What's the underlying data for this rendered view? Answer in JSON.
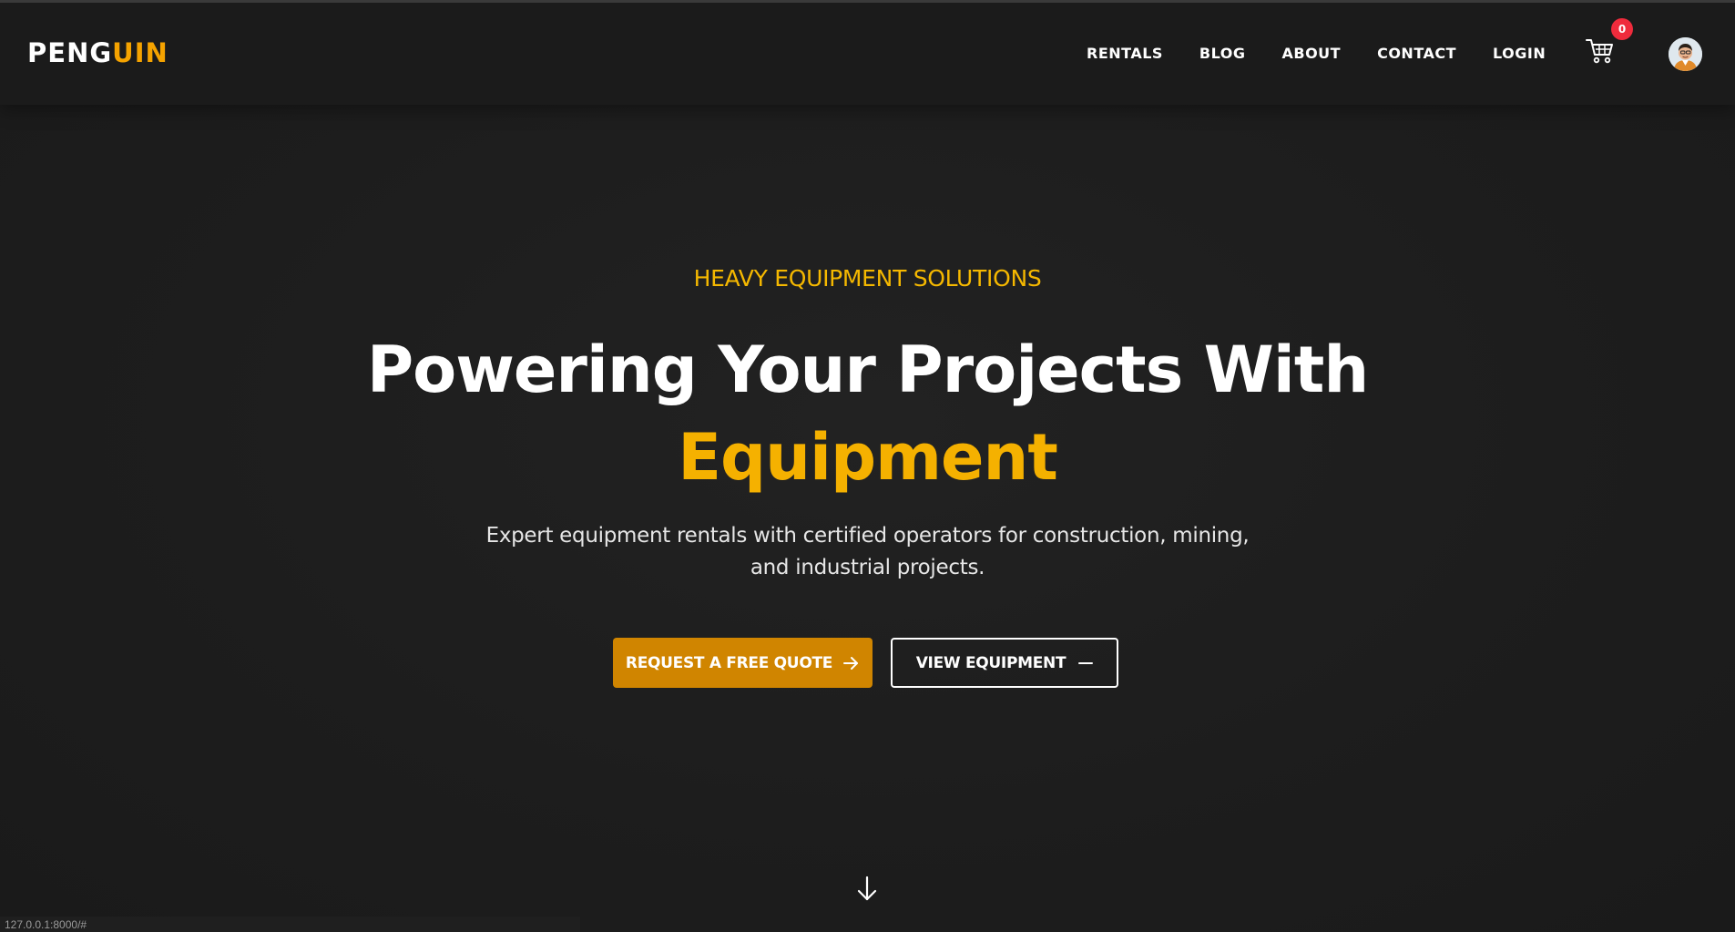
{
  "header": {
    "logo_main": "PENG",
    "logo_accent": "UIN",
    "nav": {
      "rentals": "RENTALS",
      "blog": "BLOG",
      "about": "ABOUT",
      "contact": "CONTACT",
      "login": "LOGIN"
    },
    "cart_icon": "shopping-cart-icon",
    "cart_count": "0",
    "avatar_icon": "user-avatar"
  },
  "hero": {
    "eyebrow": "HEAVY EQUIPMENT SOLUTIONS",
    "title_line1": "Powering Your Projects With",
    "title_highlight": "Equipment",
    "subtitle": "Expert equipment rentals with certified operators for construction, mining, and industrial projects.",
    "primary_button": "REQUEST A FREE QUOTE",
    "primary_button_icon": "arrow-right-icon",
    "secondary_button": "VIEW EQUIPMENT",
    "secondary_button_icon": "minus-icon",
    "scroll_icon": "arrow-down-icon"
  },
  "status_bar": {
    "url": "127.0.0.1:8000/#"
  },
  "colors": {
    "background": "#1c1c1c",
    "accent": "#f5b100",
    "primary_button": "#d08500",
    "badge": "#ef2b3c"
  }
}
